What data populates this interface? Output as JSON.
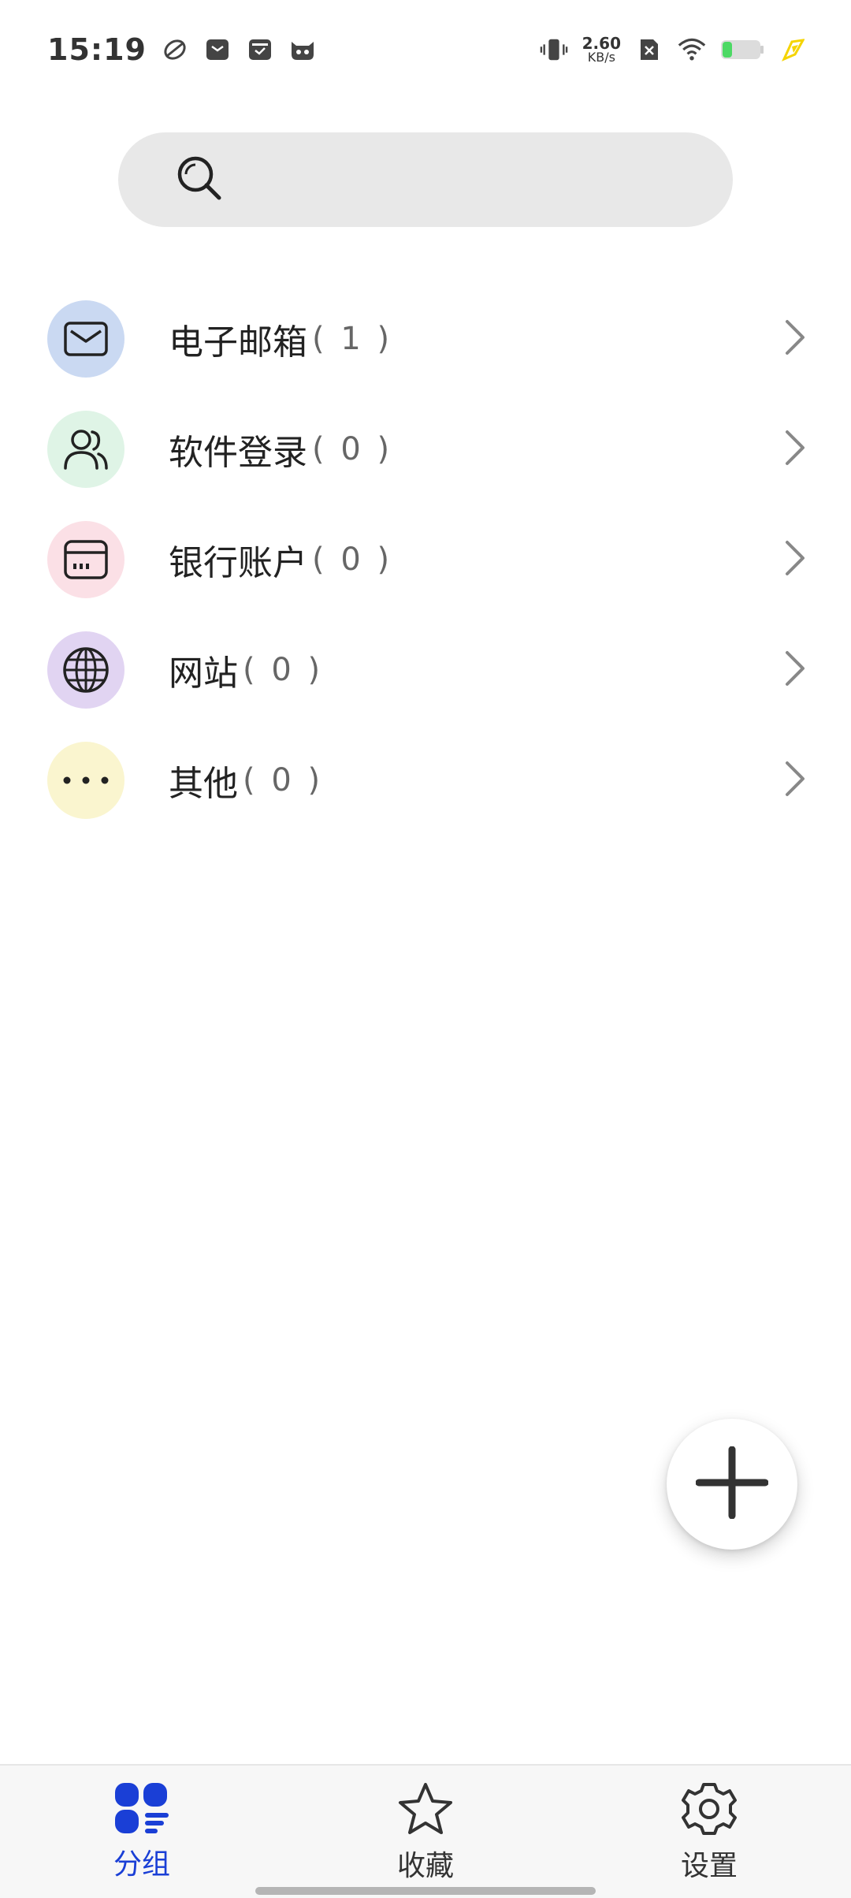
{
  "status_bar": {
    "time": "15:19",
    "net_speed_value": "2.60",
    "net_speed_unit": "KB/s",
    "battery_color": "#4cd964",
    "charging_color": "#f5d400"
  },
  "search": {
    "placeholder": "",
    "icon": "search-icon"
  },
  "categories": [
    {
      "label": "电子邮箱",
      "count": "( 1 )",
      "icon": "mail-icon",
      "bg": "#cad9f2"
    },
    {
      "label": "软件登录",
      "count": "( 0 )",
      "icon": "users-icon",
      "bg": "#dff4e6"
    },
    {
      "label": "银行账户",
      "count": "( 0 )",
      "icon": "card-icon",
      "bg": "#fbe0e6"
    },
    {
      "label": "网站",
      "count": "( 0 )",
      "icon": "globe-icon",
      "bg": "#e1d4f2"
    },
    {
      "label": "其他",
      "count": "( 0 )",
      "icon": "more-icon",
      "bg": "#faf5cf"
    }
  ],
  "fab": {
    "icon": "plus-icon"
  },
  "bottom_nav": {
    "active_color": "#1a3fd6",
    "items": [
      {
        "label": "分组",
        "icon": "groups-icon",
        "active": true
      },
      {
        "label": "收藏",
        "icon": "star-icon",
        "active": false
      },
      {
        "label": "设置",
        "icon": "gear-icon",
        "active": false
      }
    ]
  }
}
